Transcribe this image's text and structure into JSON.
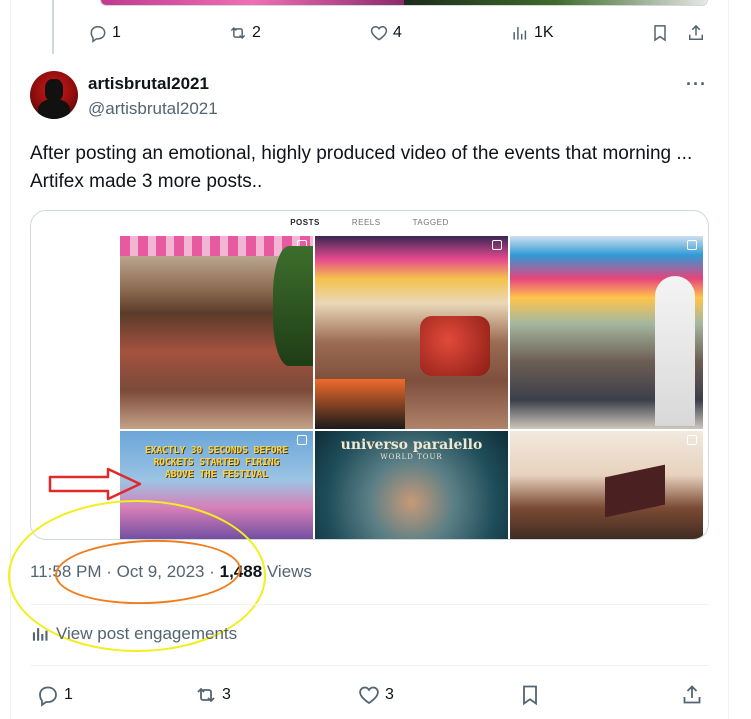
{
  "previous_tweet": {
    "actions": {
      "replies": "1",
      "reposts": "2",
      "likes": "4",
      "views": "1K"
    }
  },
  "tweet": {
    "display_name": "artisbrutal2021",
    "handle": "@artisbrutal2021",
    "more_label": "···",
    "text": "After posting an emotional, highly produced video of the events that morning ... Artifex made 3 more posts..",
    "media": {
      "tabs": [
        "POSTS",
        "REELS",
        "TAGGED"
      ],
      "active_tab": "POSTS",
      "grid_captions": {
        "cell4": [
          "EXACTLY 30 SECONDS BEFORE",
          "ROCKETS STARTED FIRING",
          "ABOVE THE FESTIVAL"
        ],
        "cell5_title": "universo paralello",
        "cell5_sub": "WORLD TOUR"
      }
    },
    "time": "11:58 PM",
    "separator": " · ",
    "date": "Oct 9, 2023",
    "views_count": "1,488",
    "views_label": " Views",
    "engagements_label": "View post engagements",
    "actions": {
      "replies": "1",
      "reposts": "3",
      "likes": "3"
    }
  },
  "annotations": {
    "yellow_ellipse_color": "#f3ee1d",
    "orange_ellipse_color": "#f07d1c",
    "arrow_color": "#e02a2a"
  },
  "colors": {
    "text_primary": "#0f1419",
    "text_secondary": "#536471",
    "border": "#cfd9de"
  }
}
